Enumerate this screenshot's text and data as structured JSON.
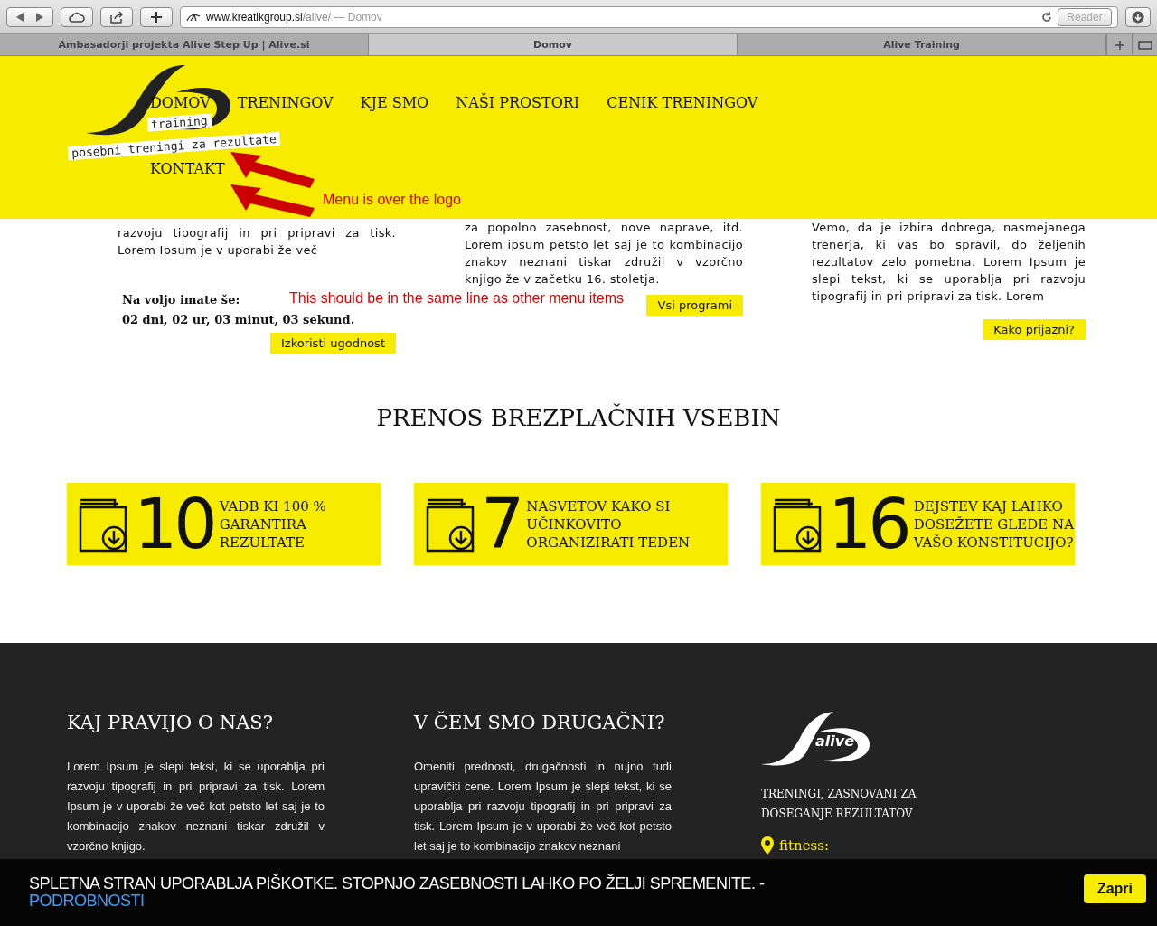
{
  "browser": {
    "url": {
      "host": "www.kreatikgroup.si",
      "path": "/alive/",
      "page_title": "— Domov"
    },
    "reader": "Reader",
    "tabs": [
      {
        "label": "Ambasadorji projekta Alive Step Up | Alive.si",
        "selected": false
      },
      {
        "label": "Domov",
        "selected": true
      },
      {
        "label": "Alive Training",
        "selected": false
      }
    ]
  },
  "header": {
    "logo": {
      "line1": "training",
      "line2": "posebni treningi za rezultate"
    },
    "menu": [
      "DOMOV",
      "TRENINGOV",
      "KJE SMO",
      "NAŠI PROSTORI",
      "CENIK TRENINGOV",
      "KONTAKT"
    ],
    "annotations": [
      "Menu is over the logo",
      "This should be in the same line as other menu items"
    ]
  },
  "offers": [
    {
      "paragraph": "razvoju tipografij in pri pripravi za tisk. Lorem Ipsum je v uporabi že več",
      "countdown": {
        "label": "Na voljo imate še:",
        "value": "02 dni, 02 ur, 03 minut, 03 sekund."
      },
      "button": "Izkoristi ugodnost"
    },
    {
      "paragraph": "za popolno zasebnost, nove naprave, itd. Lorem ipsum petsto let saj je to kombinacijo znakov neznani tiskar združil v vzorčno knjigo že v začetku 16. stoletja.",
      "button": "Vsi programi"
    },
    {
      "paragraph": "Vemo, da je izbira dobrega, nasmejanega trenerja, ki vas bo spravil, do željenih rezultatov zelo pomebna. Lorem Ipsum je slepi tekst, ki se uporablja pri razvoju tipografij in pri pripravi za tisk. Lorem",
      "button": "Kako prijazni?"
    }
  ],
  "downloads": {
    "title": "PRENOS BREZPLAČNIH VSEBIN",
    "cards": [
      {
        "number": "10",
        "text": "VADB KI 100 % GARANTIRA REZULTATE"
      },
      {
        "number": "7",
        "text": "NASVETOV KAKO SI UČINKOVITO ORGANIZIRATI TEDEN"
      },
      {
        "number": "16",
        "text": "DEJSTEV KAJ LAHKO DOSEŽETE GLEDE NA VAŠO KONSTITUCIJO?"
      }
    ]
  },
  "footer": {
    "columns": [
      {
        "title": "KAJ PRAVIJO O NAS?",
        "paragraph": "Lorem Ipsum je slepi tekst, ki se uporablja pri razvoju tipografij in pri pripravi za tisk. Lorem Ipsum je v uporabi že več kot petsto let saj je to kombinacijo znakov neznani tiskar združil v vzorčno knjigo."
      },
      {
        "title": "V ČEM SMO DRUGAČNI?",
        "paragraph": "Omeniti prednosti, drugačnosti in nujno tudi upravičiti cene. Lorem Ipsum je slepi tekst, ki se uporablja pri razvoju tipografij in pri pripravi za tisk. Lorem Ipsum je v uporabi že več kot petsto let saj je to kombinacijo znakov neznani"
      }
    ],
    "brand": {
      "logo": "alive",
      "tagline": "TRENINGI, ZASNOVANI ZA DOSEGANJE REZULTATOV",
      "location": "fitness:"
    }
  },
  "cookie": {
    "text": "SPLETNA STRAN UPORABLJA PIŠKOTKE. STOPNJO ZASEBNOSTI LAHKO PO ŽELJI SPREMENITE. -",
    "link": "PODROBNOSTI",
    "button": "Zapri"
  }
}
